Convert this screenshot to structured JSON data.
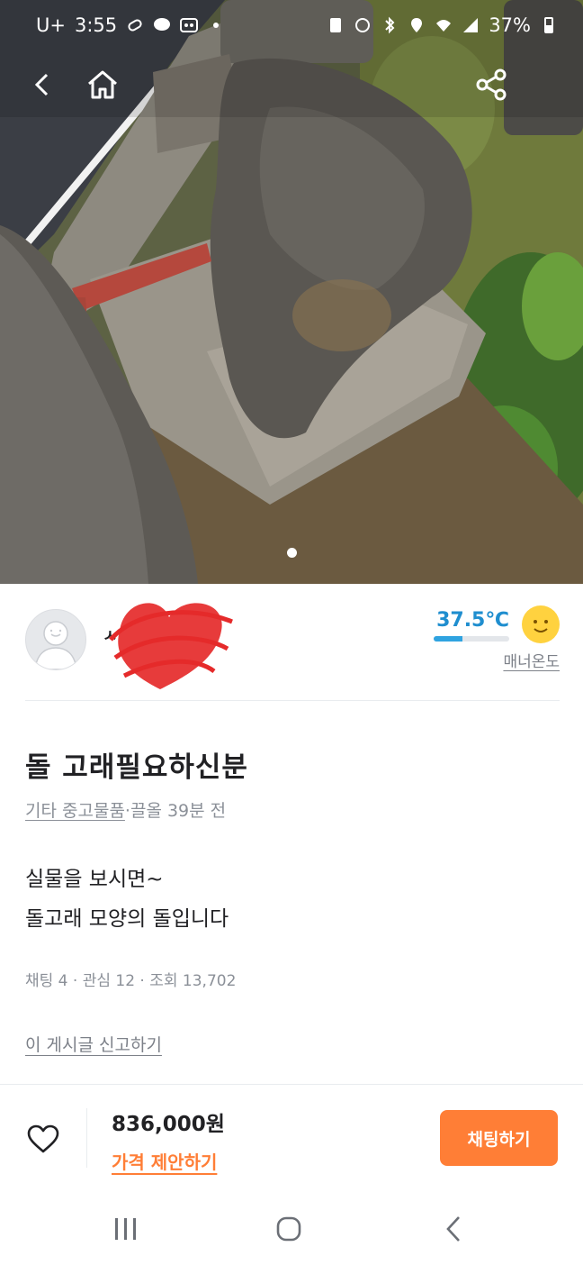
{
  "status_bar": {
    "time": "3:55",
    "carrier": "U+",
    "battery": "37%",
    "icons": [
      "link-icon",
      "talk-icon",
      "voicemail-icon",
      "dot-icon",
      "sim-icon",
      "alarm-icon",
      "bluetooth-icon",
      "location-icon",
      "wifi-icon",
      "signal-icon",
      "battery-icon"
    ]
  },
  "top_bar": {
    "icons": [
      "back-arrow-icon",
      "home-icon",
      "share-icon"
    ]
  },
  "photo": {
    "current_page": 1,
    "total_pages": 1
  },
  "seller": {
    "nickname": "ㅅ",
    "manner_temp": "37.5℃",
    "manner_temp_value": 37.5,
    "manner_label": "매너온도",
    "temp_color": "#1f8ecf"
  },
  "post": {
    "title": "돌 고래필요하신분",
    "category": "기타 중고물품",
    "meta_separator": "·",
    "meta_rest": "끌올 39분 전",
    "description_lines": [
      "실물을 보시면~",
      "돌고래 모양의 돌입니다"
    ],
    "stats": "채팅 4 · 관심 12 · 조회 13,702",
    "report_link": "이 게시글 신고하기"
  },
  "purchase_bar": {
    "price": "836,000원",
    "offer_link": "가격 제안하기",
    "chat_button": "채팅하기",
    "accent_color": "#ff7e36"
  },
  "nav_bar": {
    "icons": [
      "recent-apps-icon",
      "home-circle-icon",
      "back-chevron-icon"
    ]
  }
}
